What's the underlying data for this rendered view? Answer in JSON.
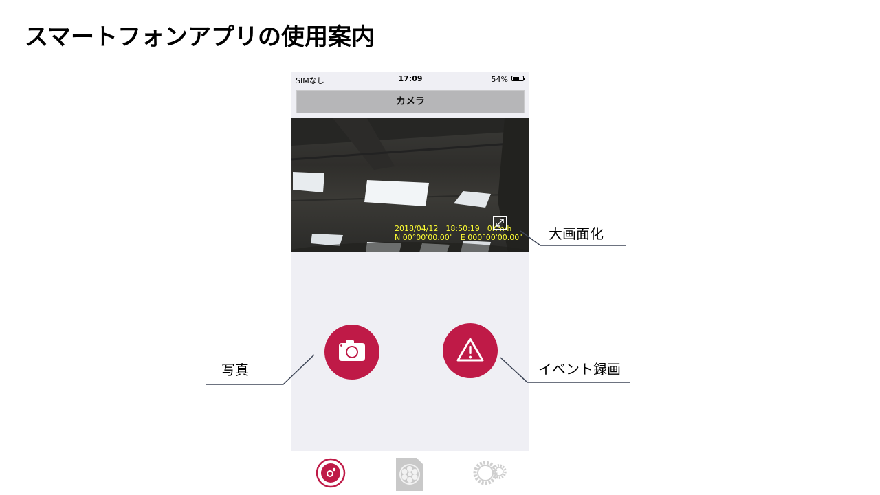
{
  "slide": {
    "title": "スマートフォンアプリの使用案内"
  },
  "status_bar": {
    "carrier": "SIMなし",
    "time": "17:09",
    "battery": "54%",
    "battery_level": 0.54
  },
  "nav": {
    "title": "カメラ"
  },
  "camera_feed": {
    "overlay_line1": "2018/04/12　18:50:19　0Km/h",
    "overlay_line2": "N 00°00'00.00\"　E 000°00'00.00\"",
    "overlay_color": "#ffff33"
  },
  "actions": {
    "photo_icon": "camera-icon",
    "event_icon": "warning-triangle-icon",
    "accent_color": "#bf1a47"
  },
  "tabbar": {
    "tabs": [
      {
        "icon": "camera-lens-icon",
        "active": true
      },
      {
        "icon": "film-reel-file-icon",
        "active": false
      },
      {
        "icon": "gear-icon",
        "active": false
      }
    ]
  },
  "callouts": {
    "enlarge": "大画面化",
    "photo": "写真",
    "event_record": "イベント録画"
  }
}
